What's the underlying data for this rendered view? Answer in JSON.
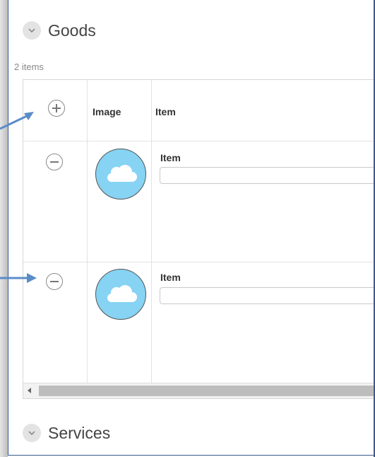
{
  "goods": {
    "title": "Goods",
    "count_label": "2 items",
    "columns": {
      "image": "Image",
      "item": "Item"
    },
    "rows": [
      {
        "field_label": "Item",
        "field_value": ""
      },
      {
        "field_label": "Item",
        "field_value": ""
      }
    ]
  },
  "services": {
    "title": "Services"
  },
  "icons": {
    "section_toggle": "chevron-down-icon",
    "add_row": "plus-circle-icon",
    "remove_row": "minus-circle-icon",
    "image": "cloud-icon"
  },
  "colors": {
    "frame_border": "#3a5a8c",
    "callout_arrow": "#5a8cc8",
    "avatar_fill": "#86d3f3"
  }
}
